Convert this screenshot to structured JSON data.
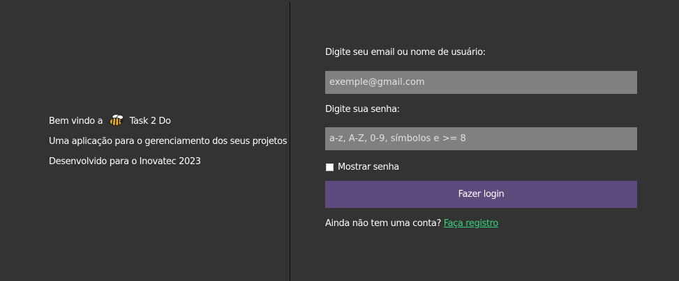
{
  "welcome": {
    "greeting_prefix": "Bem vindo a",
    "app_name": "Task 2 Do",
    "description": "Uma aplicação para o gerenciamento dos seus projetos",
    "credit": "Desenvolvido para o Inovatec 2023",
    "logo_icon": "bee-icon"
  },
  "login": {
    "email_label": "Digite seu email ou nome de usuário:",
    "email_placeholder": "exemple@gmail.com",
    "email_value": "",
    "password_label": "Digite sua senha:",
    "password_placeholder": "a-z, A-Z, 0-9, símbolos e >= 8",
    "password_value": "",
    "show_password_label": "Mostrar senha",
    "show_password_checked": false,
    "submit_label": "Fazer login",
    "no_account_text": "Ainda não tem uma conta?",
    "register_link": "Faça registro"
  },
  "colors": {
    "background": "#333333",
    "input_background": "#808080",
    "button_background": "#5f4a7e",
    "link": "#36d47b",
    "divider": "#0b0b0b"
  }
}
